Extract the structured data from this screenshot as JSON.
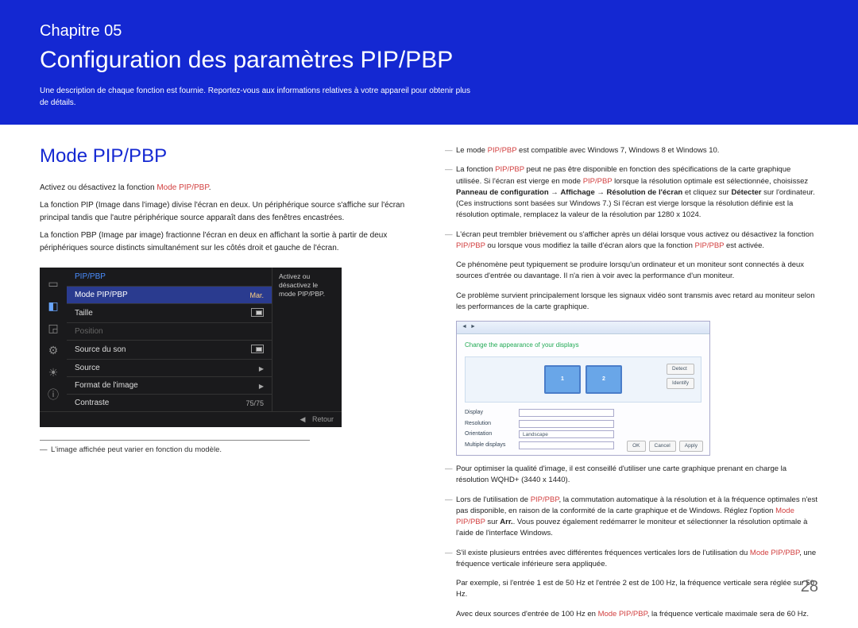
{
  "header": {
    "chapter": "Chapitre 05",
    "title": "Configuration des paramètres PIP/PBP",
    "desc": "Une description de chaque fonction est fournie. Reportez-vous aux informations relatives à votre appareil pour obtenir plus de détails."
  },
  "left": {
    "section_title": "Mode PIP/PBP",
    "p1a": "Activez ou désactivez la fonction ",
    "p1b": "Mode PIP/PBP",
    "p1c": ".",
    "p2": "La fonction PIP (Image dans l'image) divise l'écran en deux. Un périphérique source s'affiche sur l'écran principal tandis que l'autre périphérique source apparaît dans des fenêtres encastrées.",
    "p3": "La fonction PBP (Image par image) fractionne l'écran en deux en affichant la sortie à partir de deux périphériques source distincts simultanément sur les côtés droit et gauche de l'écran.",
    "footnote": "L'image affichée peut varier en fonction du modèle."
  },
  "osd": {
    "header": "PIP/PBP",
    "rows": [
      {
        "label": "Mode PIP/PBP",
        "value": "Mar.",
        "selected": true
      },
      {
        "label": "Taille",
        "value": "pip-icon"
      },
      {
        "label": "Position",
        "value": "",
        "dim": true
      },
      {
        "label": "Source du son",
        "value": "pip-icon"
      },
      {
        "label": "Source",
        "value": "▶"
      },
      {
        "label": "Format de l'image",
        "value": "▶"
      },
      {
        "label": "Contraste",
        "value": "75/75"
      }
    ],
    "side": "Activez ou désactivez le mode PIP/PBP.",
    "footer_icon": "◀",
    "footer_label": "Retour"
  },
  "right": {
    "n1a": "Le mode ",
    "n1b": "PIP/PBP",
    "n1c": " est compatible avec Windows 7, Windows 8 et Windows 10.",
    "n2a": "La fonction ",
    "n2b": "PIP/PBP",
    "n2c": " peut ne pas être disponible en fonction des spécifications de la carte graphique utilisée. Si l'écran est vierge en mode ",
    "n2d": "PIP/PBP",
    "n2e": " lorsque la résolution optimale est sélectionnée, choisissez ",
    "n2f": "Panneau de configuration",
    "n2g": " → ",
    "n2h": "Affichage",
    "n2i": " → ",
    "n2j": "Résolution de l'écran",
    "n2k": " et cliquez sur ",
    "n2l": "Détecter",
    "n2m": " sur l'ordinateur. (Ces instructions sont basées sur Windows 7.) Si l'écran est vierge lorsque la résolution définie est la résolution optimale, remplacez la valeur de la résolution par 1280 x 1024.",
    "n3a": "L'écran peut trembler brièvement ou s'afficher après un délai lorsque vous activez ou désactivez la fonction ",
    "n3b": "PIP/PBP",
    "n3c": " ou lorsque vous modifiez la taille d'écran alors que la fonction ",
    "n3d": "PIP/PBP",
    "n3e": " est activée.",
    "n3f": "Ce phénomène peut typiquement se produire lorsqu'un ordinateur et un moniteur sont connectés à deux sources d'entrée ou davantage. Il n'a rien à voir avec la performance d'un moniteur.",
    "n3g": "Ce problème survient principalement lorsque les signaux vidéo sont transmis avec retard au moniteur selon les performances de la carte graphique.",
    "n4": "Pour optimiser la qualité d'image, il est conseillé d'utiliser une carte graphique prenant en charge la résolution WQHD+ (3440 x 1440).",
    "n5a": "Lors de l'utilisation de ",
    "n5b": "PIP/PBP",
    "n5c": ", la commutation automatique à la résolution et à la fréquence optimales n'est pas disponible, en raison de la conformité de la carte graphique et de Windows. Réglez l'option ",
    "n5d": "Mode PIP/PBP",
    "n5e": " sur ",
    "n5f": "Arr.",
    "n5g": ". Vous pouvez également redémarrer le moniteur et sélectionner la résolution optimale à l'aide de l'interface Windows.",
    "n6a": "S'il existe plusieurs entrées avec différentes fréquences verticales lors de l'utilisation du ",
    "n6b": "Mode PIP/PBP",
    "n6c": ", une fréquence verticale inférieure sera appliquée.",
    "n6d": "Par exemple, si l'entrée 1 est de 50 Hz et l'entrée 2 est de 100 Hz, la fréquence verticale sera réglée sur 50 Hz.",
    "n6e": "Avec deux sources d'entrée de 100 Hz en ",
    "n6f": "Mode PIP/PBP",
    "n6g": ", la fréquence verticale maximale sera de 60 Hz."
  },
  "win": {
    "title": "Change the appearance of your displays",
    "detect": "Detect",
    "identify": "Identify",
    "mon1": "1",
    "mon2": "2",
    "rows": [
      {
        "label": "Display",
        "val": ""
      },
      {
        "label": "Resolution",
        "val": ""
      },
      {
        "label": "Orientation",
        "val": "Landscape"
      },
      {
        "label": "Multiple displays",
        "val": ""
      }
    ],
    "ok": "OK",
    "cancel": "Cancel",
    "apply": "Apply"
  },
  "page_number": "28"
}
